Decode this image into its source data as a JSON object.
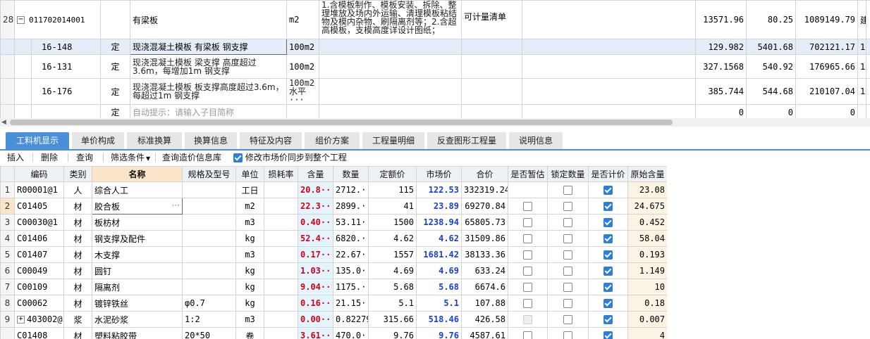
{
  "top_grid": {
    "row28": {
      "num": "28",
      "code": "011702014001",
      "name": "有梁板",
      "unit": "m2",
      "note": "1.含模板制作、模板安装、拆除、整理堆放及场内外运输、清理模板粘结物及模内杂物、刷隔离剂等；2.含超高模板，支模高度详设计图纸；",
      "measure": "可计量清单",
      "qty": "13571.96",
      "price": "80.25",
      "total": "1089149.79",
      "extra": "建"
    },
    "subrows": [
      {
        "code": "16-148",
        "type": "定",
        "name": "现浇混凝土模板 有梁板 钢支撑",
        "unit": "100m2",
        "qty": "129.982",
        "price": "5401.68",
        "total": "702121.17",
        "extra": "1"
      },
      {
        "code": "16-131",
        "type": "定",
        "name": "现浇混凝土模板 梁支撑 高度超过3.6m，每增加1m 钢支撑",
        "unit": "100m2",
        "qty": "327.1568",
        "price": "540.92",
        "total": "176965.66",
        "extra": "1"
      },
      {
        "code": "16-176",
        "type": "定",
        "name": "现浇混凝土模板 板支撑高度超过3.6m，每超过1m 钢支撑",
        "unit": "100m2 水平···",
        "qty": "385.744",
        "price": "544.68",
        "total": "210107.04",
        "extra": "1"
      },
      {
        "code": "",
        "type": "定",
        "name": "自动提示：请输入子目简称",
        "unit": "",
        "qty": "0",
        "price": "0",
        "total": "0",
        "extra": ""
      }
    ]
  },
  "tabs": [
    "工料机显示",
    "单价构成",
    "标准换算",
    "换算信息",
    "特征及内容",
    "组价方案",
    "工程量明细",
    "反查图形工程量",
    "说明信息"
  ],
  "toolbar": {
    "insert": "插入",
    "delete": "删除",
    "query": "查询",
    "filter": "筛选条件",
    "query_price": "查询造价信息库",
    "sync_label": "修改市场价同步到整个工程"
  },
  "bottom_grid": {
    "headers": [
      "编码",
      "类别",
      "名称",
      "规格及型号",
      "单位",
      "损耗率",
      "含量",
      "数量",
      "定额价",
      "市场价",
      "合价",
      "是否暂估",
      "锁定数量",
      "是否计价",
      "原始含量"
    ],
    "rows": [
      {
        "num": "1",
        "code": "R00001@1",
        "cat": "人",
        "name": "综合人工",
        "spec": "",
        "unit": "工日",
        "loss": "",
        "content": "20.8···",
        "qty": "2712.···",
        "quota": "115",
        "market": "122.53",
        "total": "332319.24",
        "est": "none",
        "lock": false,
        "priced": true,
        "orig": "23.08"
      },
      {
        "num": "2",
        "code": "C01405",
        "cat": "材",
        "name": "胶合板",
        "spec": "",
        "unit": "m2",
        "loss": "",
        "content": "22.3···",
        "qty": "2899.···",
        "quota": "41",
        "market": "23.89",
        "total": "69270.84",
        "est": "off",
        "lock": false,
        "priced": true,
        "orig": "24.675"
      },
      {
        "num": "3",
        "code": "C00030@1",
        "cat": "材",
        "name": "板枋材",
        "spec": "",
        "unit": "m3",
        "loss": "",
        "content": "0.40···",
        "qty": "53.11···",
        "quota": "1500",
        "market": "1238.94",
        "total": "65805.73",
        "est": "off",
        "lock": false,
        "priced": true,
        "orig": "0.452"
      },
      {
        "num": "4",
        "code": "C01406",
        "cat": "材",
        "name": "钢支撑及配件",
        "spec": "",
        "unit": "kg",
        "loss": "",
        "content": "52.4···",
        "qty": "6820.···",
        "quota": "4.62",
        "market": "4.62",
        "total": "31509.86",
        "est": "off",
        "lock": false,
        "priced": true,
        "orig": "58.04"
      },
      {
        "num": "5",
        "code": "C01407",
        "cat": "材",
        "name": "木支撑",
        "spec": "",
        "unit": "m3",
        "loss": "",
        "content": "0.17···",
        "qty": "22.67···",
        "quota": "1557",
        "market": "1681.42",
        "total": "38133.36",
        "est": "off",
        "lock": false,
        "priced": true,
        "orig": "0.193"
      },
      {
        "num": "6",
        "code": "C00049",
        "cat": "材",
        "name": "圆钉",
        "spec": "",
        "unit": "kg",
        "loss": "",
        "content": "1.03···",
        "qty": "135.0···",
        "quota": "4.69",
        "market": "4.69",
        "total": "633.24",
        "est": "off",
        "lock": false,
        "priced": true,
        "orig": "1.149"
      },
      {
        "num": "7",
        "code": "C00109",
        "cat": "材",
        "name": "隔离剂",
        "spec": "",
        "unit": "kg",
        "loss": "",
        "content": "9.04···",
        "qty": "1175.···",
        "quota": "5.68",
        "market": "5.68",
        "total": "6674.6",
        "est": "off",
        "lock": false,
        "priced": true,
        "orig": "10"
      },
      {
        "num": "8",
        "code": "C00062",
        "cat": "材",
        "name": "镀锌铁丝",
        "spec": "φ0.7",
        "unit": "kg",
        "loss": "",
        "content": "0.16···",
        "qty": "21.15···",
        "quota": "5.1",
        "market": "5.1",
        "total": "107.88",
        "est": "off",
        "lock": false,
        "priced": true,
        "orig": "0.18"
      },
      {
        "num": "9",
        "code": "403002@1",
        "cat": "浆",
        "name": "水泥砂浆",
        "spec": "1:2",
        "unit": "m3",
        "loss": "",
        "content": "0.00···",
        "qty": "0.82279",
        "quota": "315.66",
        "market": "518.46",
        "total": "426.58",
        "est": "dis",
        "lock": false,
        "priced": true,
        "orig": "0.007"
      },
      {
        "num": "",
        "code": "C01408",
        "cat": "材",
        "name": "塑料粘胶带",
        "spec": "20*50",
        "unit": "卷",
        "loss": "",
        "content": "3.61···",
        "qty": "470.0···",
        "quota": "9.76",
        "market": "9.76",
        "total": "4587.61",
        "est": "off",
        "lock": false,
        "priced": true,
        "orig": "4"
      }
    ]
  },
  "colors": {
    "accent": "#4a90d9",
    "content_red": "#d0021b",
    "market_blue": "#1a3fcf",
    "name_header": "#fbe5c8"
  }
}
